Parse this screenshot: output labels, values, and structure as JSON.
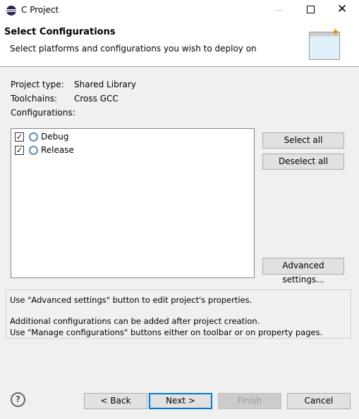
{
  "window": {
    "title": "C Project"
  },
  "header": {
    "title": "Select Configurations",
    "subtitle": "Select platforms and configurations you wish to deploy on"
  },
  "fields": [
    {
      "label": "Project type:",
      "value": "Shared Library"
    },
    {
      "label": "Toolchains:",
      "value": "Cross GCC"
    }
  ],
  "configurations_label": "Configurations:",
  "configurations": [
    {
      "name": "Debug",
      "checked": true
    },
    {
      "name": "Release",
      "checked": true
    }
  ],
  "buttons": {
    "select_all": "Select all",
    "deselect_all": "Deselect all",
    "advanced": "Advanced settings...",
    "back": "< Back",
    "next": "Next >",
    "finish": "Finish",
    "cancel": "Cancel"
  },
  "info": {
    "line1": "Use \"Advanced settings\" button to edit project's properties.",
    "line2": "Additional configurations can be added after project creation.",
    "line3": "Use \"Manage configurations\" buttons either on toolbar or on property pages."
  }
}
